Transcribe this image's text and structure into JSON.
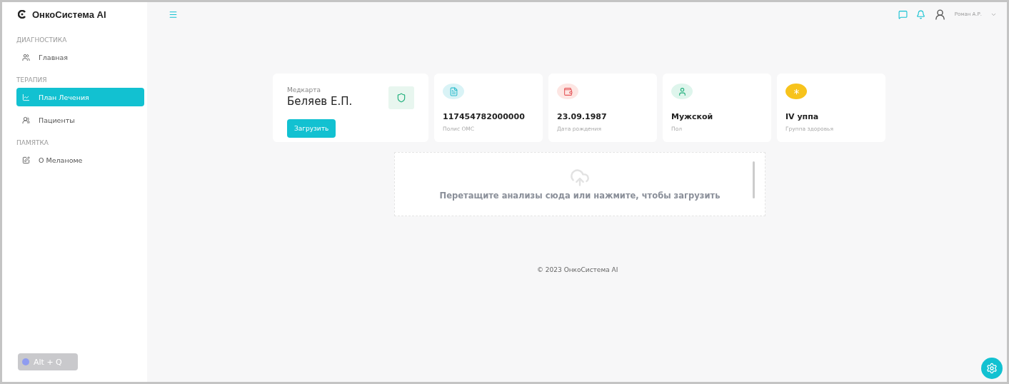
{
  "brand": "ОнкоСистема AI",
  "sidebar": {
    "sections": [
      {
        "title": "ДИАГНОСТИКА",
        "items": [
          {
            "label": "Главная",
            "kind": "users",
            "selected": false
          }
        ]
      },
      {
        "title": "ТЕРАПИЯ",
        "items": [
          {
            "label": "План Лечения",
            "kind": "chart",
            "selected": true
          },
          {
            "label": "Пациенты",
            "kind": "group",
            "selected": false
          }
        ]
      },
      {
        "title": "ПАМЯТКА",
        "items": [
          {
            "label": "О Меланоме",
            "kind": "edit",
            "selected": false
          }
        ]
      }
    ]
  },
  "shortcut": "Alt + Q",
  "user": {
    "name": "Роман А.Р."
  },
  "patient": {
    "caption": "Медкарта",
    "name": "Беляев Е.П.",
    "button": "Загрузить"
  },
  "stats": [
    {
      "value": "117454782000000",
      "label": "Полис ОМС",
      "kind": "file",
      "color": "#d9f3f6"
    },
    {
      "value": "23.09.1987",
      "label": "Дата рождения",
      "kind": "wallet",
      "color": "#fde6e3"
    },
    {
      "value": "Мужской",
      "label": "Пол",
      "kind": "person",
      "color": "#def5ec"
    },
    {
      "value": "IV уппа",
      "label": "Группа здоровья",
      "kind": "asterisk",
      "color": "#f7c31c"
    }
  ],
  "upload": {
    "text": "Перетащите анализы сюда или нажмите, чтобы загрузить"
  },
  "footer": "© 2023 ОнкоСистема AI"
}
